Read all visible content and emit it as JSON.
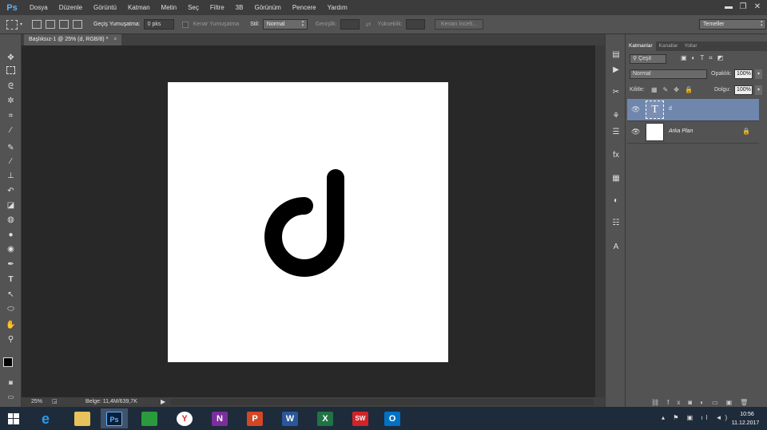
{
  "app": {
    "logo": "Ps"
  },
  "menu": [
    "Dosya",
    "Düzenle",
    "Görüntü",
    "Katman",
    "Metin",
    "Seç",
    "Filtre",
    "3B",
    "Görünüm",
    "Pencere",
    "Yardım"
  ],
  "window_controls": {
    "minimize": "▬",
    "restore": "❐",
    "close": "✕"
  },
  "options": {
    "feather_label": "Geçiş Yumuşatma:",
    "feather_value": "0 pks",
    "antialias_label": "Kenar Yumuşatma",
    "style_label": "Stil:",
    "style_value": "Normal",
    "width_label": "Genişlik:",
    "height_label": "Yükseklik:",
    "refine_button": "Kenarı İncelt...",
    "workspace": "Temeller"
  },
  "document": {
    "tab_title": "Başlıksız-1 @ 25% (d, RGB/8) *",
    "close": "×"
  },
  "status": {
    "zoom": "25%",
    "doc_info": "Belge: 11,4M/639,7K"
  },
  "panel": {
    "tabs": [
      "Katmanlar",
      "Kanallar",
      "Yollar"
    ],
    "filter_kind": "Çeşit",
    "blend_mode": "Normal",
    "opacity_label": "Opaklık:",
    "opacity_value": "100%",
    "lock_label": "Kilitle:",
    "fill_label": "Dolgu:",
    "fill_value": "100%",
    "layers": [
      {
        "name": "d",
        "type": "text",
        "thumb": "T",
        "visible": true,
        "selected": true
      },
      {
        "name": "Arka Plan",
        "type": "background",
        "visible": true,
        "selected": false,
        "locked": true
      }
    ]
  },
  "taskbar": {
    "time": "10:56",
    "date": "11.12.2017",
    "apps": [
      {
        "name": "internet-explorer",
        "glyph": "e",
        "color": "#1e8ae0"
      },
      {
        "name": "file-explorer",
        "glyph": "",
        "color": "#e8c25a"
      },
      {
        "name": "photoshop",
        "glyph": "Ps",
        "color": "#0b1f3a"
      },
      {
        "name": "store",
        "glyph": "",
        "color": "#2a9b3c"
      },
      {
        "name": "yandex-browser",
        "glyph": "Y",
        "color": "#ffffff"
      },
      {
        "name": "onenote",
        "glyph": "N",
        "color": "#7b2f9c"
      },
      {
        "name": "powerpoint",
        "glyph": "P",
        "color": "#d24726"
      },
      {
        "name": "word",
        "glyph": "W",
        "color": "#2b579a"
      },
      {
        "name": "excel",
        "glyph": "X",
        "color": "#217346"
      },
      {
        "name": "solidworks",
        "glyph": "SW",
        "color": "#d2232a"
      },
      {
        "name": "outlook",
        "glyph": "O",
        "color": "#0072c6"
      }
    ]
  },
  "colors": {
    "accent_selected_layer": "#6f86ad",
    "ps_blue": "#5fb2ff"
  }
}
